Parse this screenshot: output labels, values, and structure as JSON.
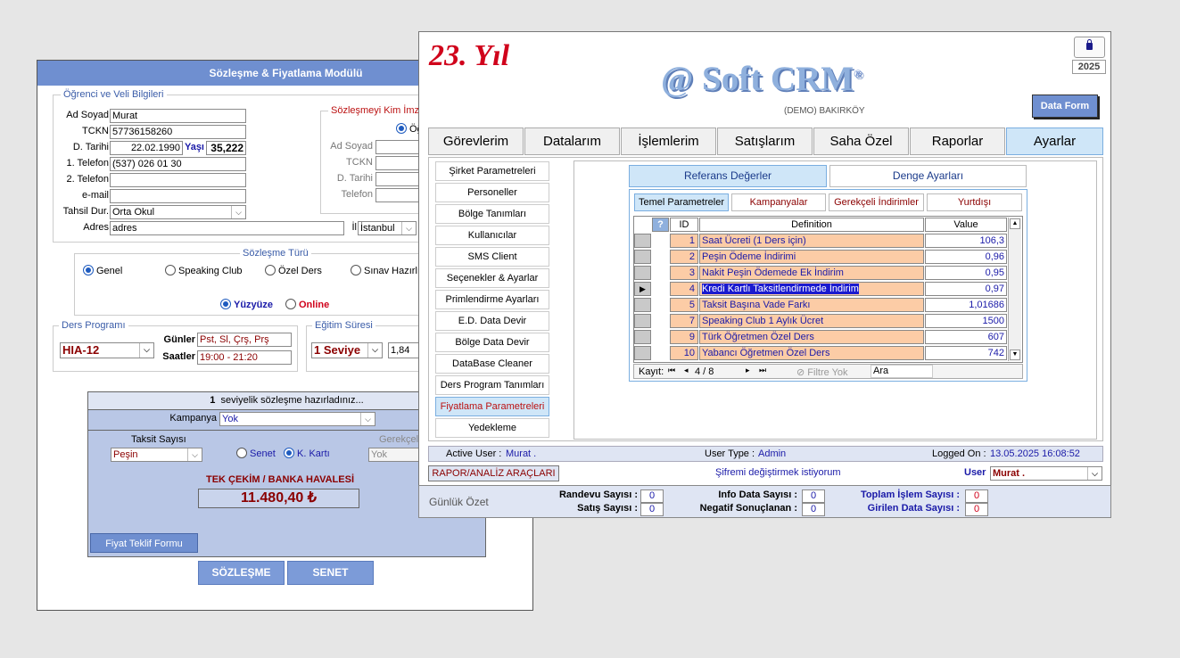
{
  "back": {
    "title": "Sözleşme & Fiyatlama Modülü",
    "student_group": "Öğrenci ve Veli Bilgileri",
    "fields": {
      "ad_soyad_label": "Ad Soyad",
      "ad_soyad": "Murat",
      "tckn_label": "TCKN",
      "tckn": "57736158260",
      "dtarihi_label": "D. Tarihi",
      "dtarihi": "22.02.1990",
      "yas_label": "Yaşı",
      "yas": "35,222",
      "tel1_label": "1. Telefon",
      "tel1": "(537) 026 01 30",
      "tel2_label": "2. Telefon",
      "tel2": "",
      "email_label": "e-mail",
      "email": "",
      "tahsil_label": "Tahsil Dur.",
      "tahsil": "Orta Okul",
      "adres_label": "Adres",
      "adres": "adres",
      "il_label": "İl",
      "il": "İstanbul"
    },
    "signer_group": "Sözleşmeyi Kim İmzal",
    "signer_radio": "Öğ",
    "signer_fields": {
      "ad_soyad": "Ad Soyad",
      "tckn": "TCKN",
      "dtarihi": "D. Tarihi",
      "telefon": "Telefon"
    },
    "contract_type_title": "Sözleşme Türü",
    "contract_types": [
      "Genel",
      "Speaking Club",
      "Özel Ders",
      "Sınav Hazırlık"
    ],
    "mode_options": [
      "Yüzyüze",
      "Online"
    ],
    "ders_group": "Ders Programı",
    "ders_program": "HIA-12",
    "gunler_label": "Günler",
    "gunler": "Pst, Sl, Çrş, Prş",
    "saatler_label": "Saatler",
    "saatler": "19:00 - 21:20",
    "egitim_group": "Eğitim Süresi",
    "egitim_seviye": "1 Seviye",
    "egitim_value": "1,84",
    "summary_count": "1",
    "summary_text": "seviyelik sözleşme hazırladınız...",
    "kampanya_label": "Kampanya",
    "kampanya": "Yok",
    "taksit_label": "Taksit Sayısı",
    "taksit": "Peşin",
    "payment_options": [
      "Senet",
      "K. Kartı"
    ],
    "gerekceli_label": "Gerekçeli",
    "gerekceli": "Yok",
    "tek_cekim_label": "TEK ÇEKİM / BANKA HAVALESİ",
    "total": "11.480,40 ₺",
    "fiyat_teklif": "Fiyat Teklif Formu",
    "sozlesme_btn": "SÖZLEŞME",
    "senet_btn": "SENET"
  },
  "front": {
    "year_badge": "23. Yıl",
    "logo_text": "@ Soft CRM",
    "logo_reg": "®",
    "subtitle": "(DEMO) BAKIRKÖY",
    "year": "2025",
    "data_form_btn": "Data Form",
    "tabs": [
      "Görevlerim",
      "Datalarım",
      "İşlemlerim",
      "Satışlarım",
      "Saha Özel",
      "Raporlar",
      "Ayarlar"
    ],
    "side_items": [
      "Şirket Parametreleri",
      "Personeller",
      "Bölge Tanımları",
      "Kullanıcılar",
      "SMS Client",
      "Seçenekler & Ayarlar",
      "Primlendirme Ayarları",
      "E.D. Data Devir",
      "Bölge Data Devir",
      "DataBase Cleaner",
      "Ders Program Tanımları",
      "Fiyatlama Parametreleri",
      "Yedekleme"
    ],
    "top_tabs": [
      "Referans Değerler",
      "Denge Ayarları"
    ],
    "sub_tabs": [
      "Temel Parametreler",
      "Kampanyalar",
      "Gerekçeli İndirimler",
      "Yurtdışı"
    ],
    "grid_headers": {
      "q": "?",
      "id": "ID",
      "def": "Definition",
      "val": "Value"
    },
    "grid_rows": [
      {
        "id": "1",
        "def": "Saat Ücreti (1 Ders için)",
        "val": "106,3"
      },
      {
        "id": "2",
        "def": "Peşin Ödeme İndirimi",
        "val": "0,96"
      },
      {
        "id": "3",
        "def": "Nakit Peşin Ödemede Ek İndirim",
        "val": "0,95"
      },
      {
        "id": "4",
        "def": "Kredi Kartlı Taksitlendirmede İndirim",
        "val": "0,97"
      },
      {
        "id": "5",
        "def": "Taksit Başına Vade Farkı",
        "val": "1,01686"
      },
      {
        "id": "7",
        "def": "Speaking Club 1 Aylık Ücret",
        "val": "1500"
      },
      {
        "id": "9",
        "def": "Türk Öğretmen Özel Ders",
        "val": "607"
      },
      {
        "id": "10",
        "def": "Yabancı Öğretmen Özel Ders",
        "val": "742"
      }
    ],
    "nav": {
      "kayit_label": "Kayıt:",
      "position": "4 / 8",
      "filter": "Filtre Yok",
      "search": "Ara"
    },
    "status": {
      "active_user_label": "Active User :",
      "active_user": "Murat .",
      "user_type_label": "User Type :",
      "user_type": "Admin",
      "logged_on_label": "Logged On :",
      "logged_on": "13.05.2025 16:08:52"
    },
    "rapor_btn": "RAPOR/ANALİZ ARAÇLARI",
    "password_link": "Şifremi değiştirmek istiyorum",
    "user_label": "User",
    "user_value": "Murat ."
  },
  "summary": {
    "title": "Günlük Özet",
    "randevu_label": "Randevu Sayısı :",
    "randevu": "0",
    "satis_label": "Satış Sayısı :",
    "satis": "0",
    "info_label": "Info Data Sayısı :",
    "info": "0",
    "negatif_label": "Negatif Sonuçlanan :",
    "negatif": "0",
    "toplam_label": "Toplam İşlem Sayısı :",
    "toplam": "0",
    "girilen_label": "Girilen Data Sayısı :",
    "girilen": "0"
  },
  "colors": {
    "accent": "#6f8fd0",
    "highlight_row": "#fccca6",
    "brand_red": "#d0021b",
    "selection": "#1a1acf"
  }
}
